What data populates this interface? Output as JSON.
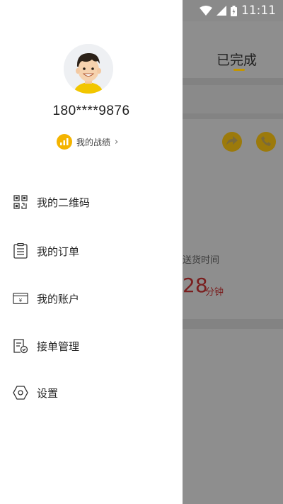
{
  "status_bar": {
    "time": "11:11"
  },
  "background": {
    "tab_label": "已完成",
    "delivery_label": "送货时间",
    "delivery_minutes": "28",
    "delivery_unit": "分钟"
  },
  "drawer": {
    "phone": "180****9876",
    "record_label": "我的战绩",
    "record_chevron": "›",
    "menu": [
      {
        "label": "我的二维码",
        "icon": "qr-code-icon"
      },
      {
        "label": "我的订单",
        "icon": "order-list-icon"
      },
      {
        "label": "我的账户",
        "icon": "wallet-icon"
      },
      {
        "label": "接单管理",
        "icon": "order-manage-icon"
      },
      {
        "label": "设置",
        "icon": "settings-hex-icon"
      }
    ]
  },
  "colors": {
    "accent": "#f4b400",
    "dim_overlay": "#8e8e8e",
    "drawer_bg": "#ffffff"
  }
}
